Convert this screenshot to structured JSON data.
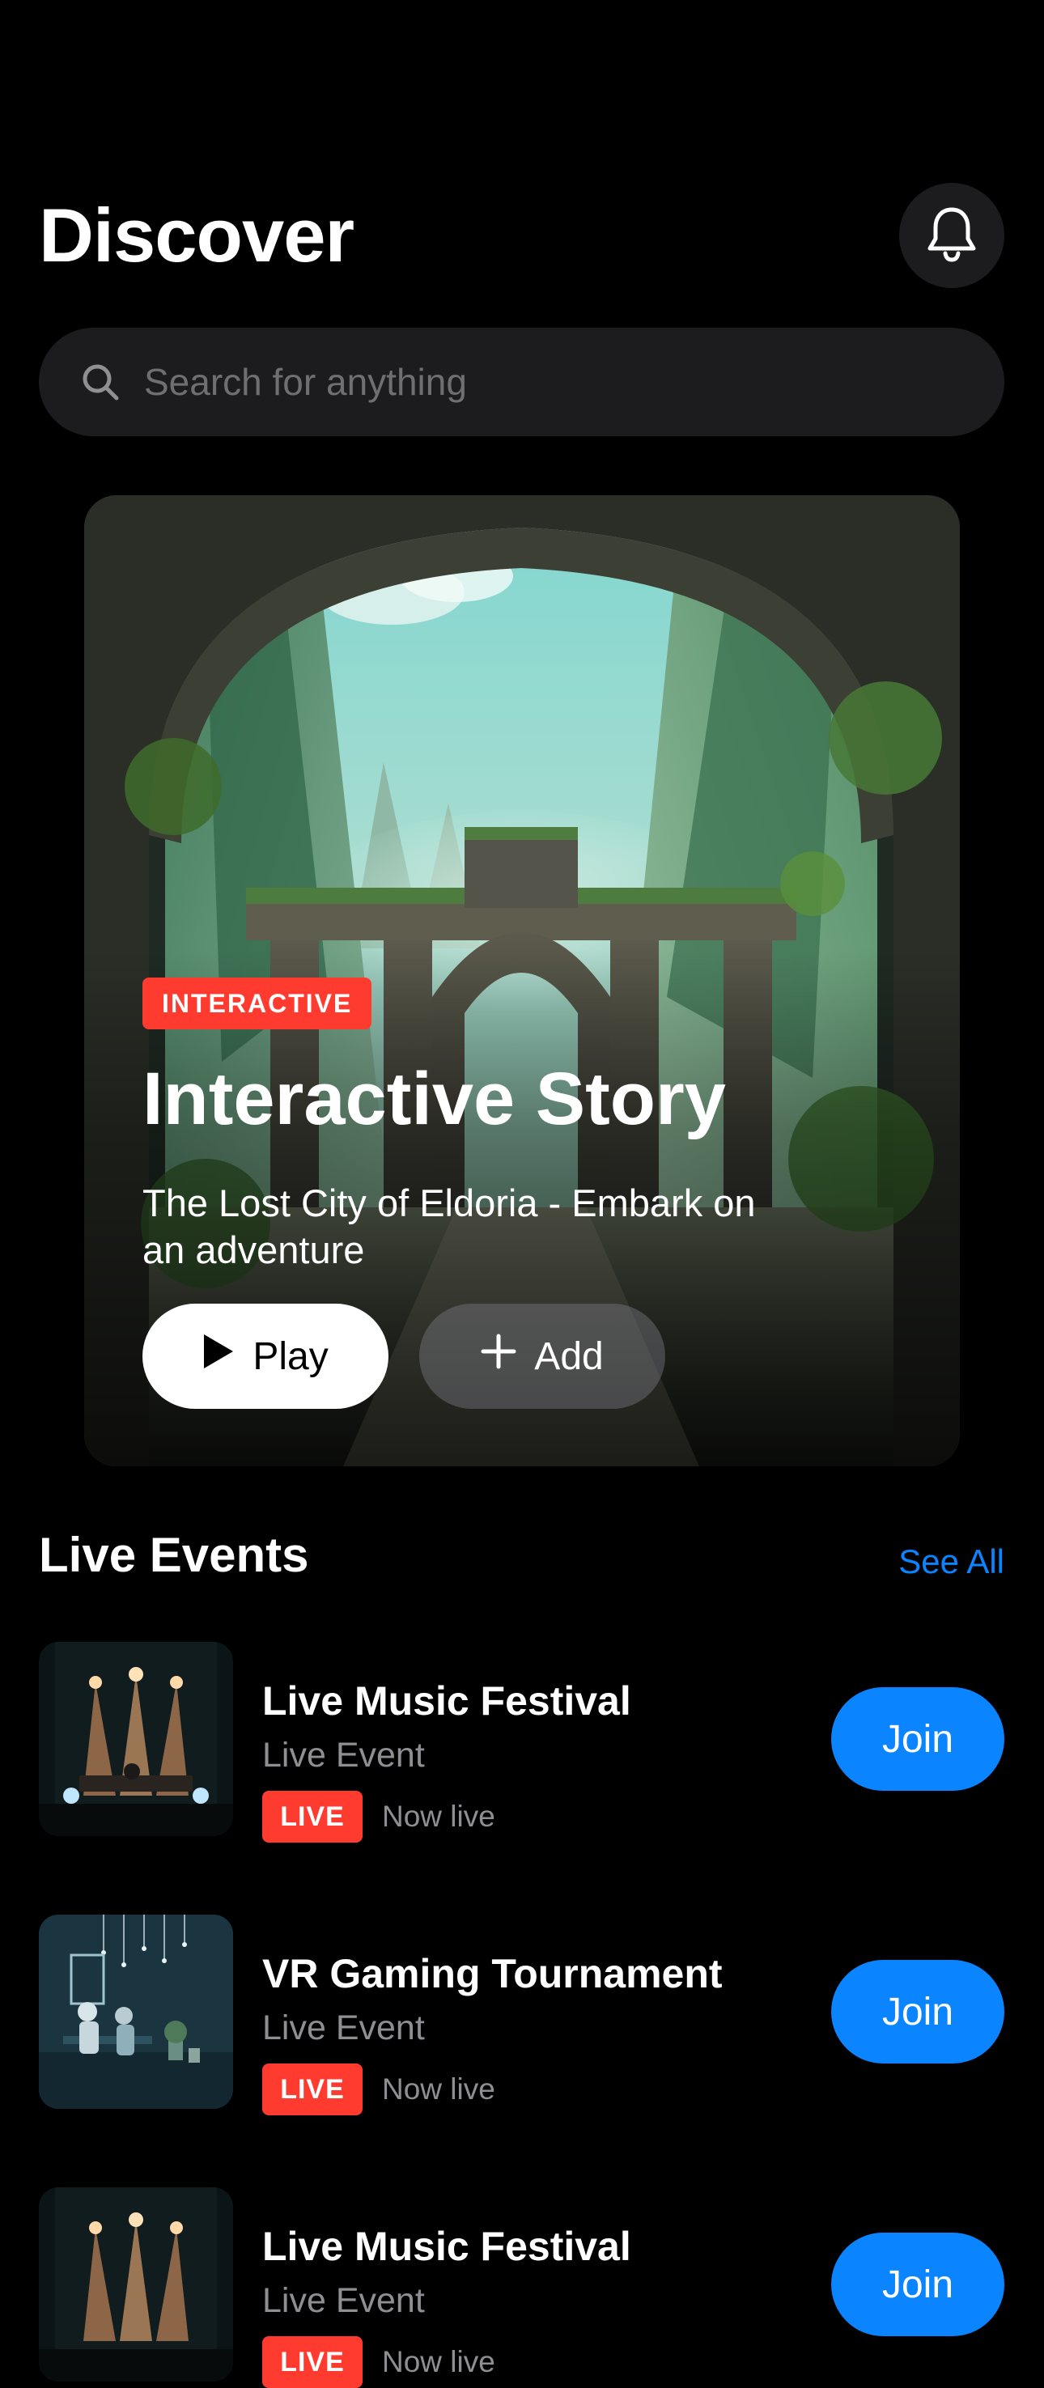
{
  "header": {
    "title": "Discover",
    "notifications_icon": "bell-icon"
  },
  "search": {
    "placeholder": "Search for anything",
    "value": "",
    "icon": "search-icon"
  },
  "featured": {
    "badge": "INTERACTIVE",
    "title": "Interactive Story",
    "subtitle": "The Lost City of Eldoria - Embark on an adventure",
    "play_label": "Play",
    "add_label": "Add",
    "play_icon": "play-icon",
    "add_icon": "plus-icon",
    "image": "ruined stone archway in a misty green canyon"
  },
  "live_events": {
    "title": "Live Events",
    "see_all": "See All",
    "items": [
      {
        "name": "Live Music Festival",
        "type": "Live Event",
        "badge": "LIVE",
        "status": "Now live",
        "action": "Join",
        "image": "concert stage with spotlights"
      },
      {
        "name": "VR Gaming Tournament",
        "type": "Live Event",
        "badge": "LIVE",
        "status": "Now live",
        "action": "Join",
        "image": "players with VR headsets on a teal stage"
      },
      {
        "name": "Live Music Festival",
        "type": "Live Event",
        "badge": "LIVE",
        "status": "Now live",
        "action": "Join",
        "image": "concert stage with spotlights"
      }
    ]
  },
  "colors": {
    "background": "#000000",
    "surface": "#1c1c1e",
    "accent": "#0a84ff",
    "live": "#ff3b30",
    "secondary_text": "#8e8e93"
  }
}
